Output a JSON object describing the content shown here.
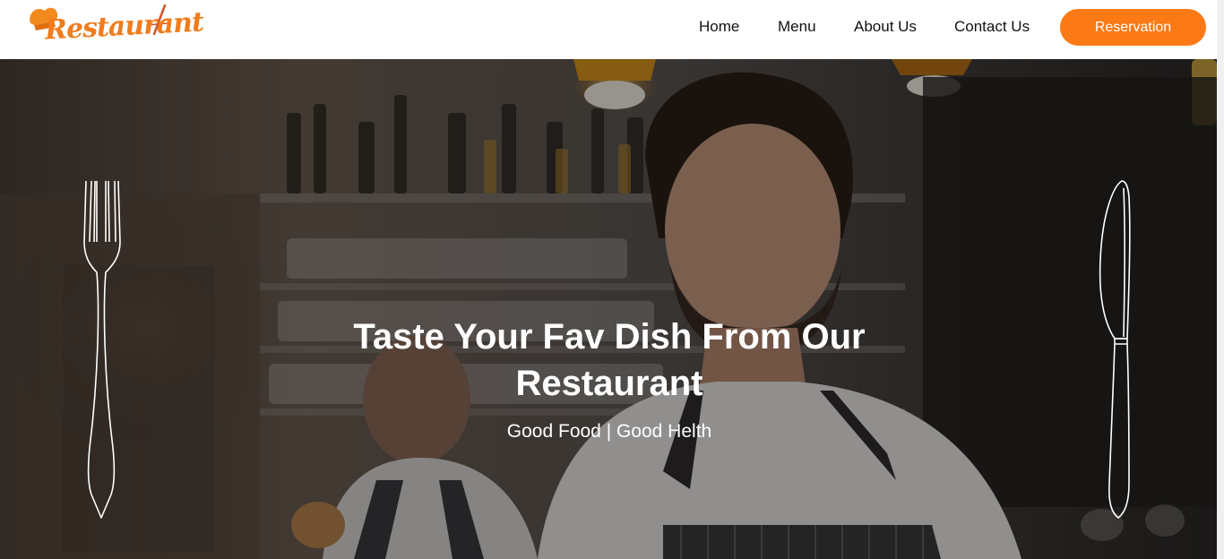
{
  "brand": {
    "logo_text": "Restaurant"
  },
  "nav": {
    "items": [
      "Home",
      "Menu",
      "About Us",
      "Contact Us"
    ],
    "cta_label": "Reservation"
  },
  "hero": {
    "title_line1": "Taste Your Fav Dish From Our",
    "title_line2": "Restaurant",
    "subtitle": "Good Food | Good Helth"
  },
  "colors": {
    "accent": "#fb7a15",
    "header_bg": "#ffffff",
    "hero_text": "#ffffff"
  },
  "icons": [
    "chef-hat-icon",
    "fork-icon",
    "knife-icon"
  ]
}
